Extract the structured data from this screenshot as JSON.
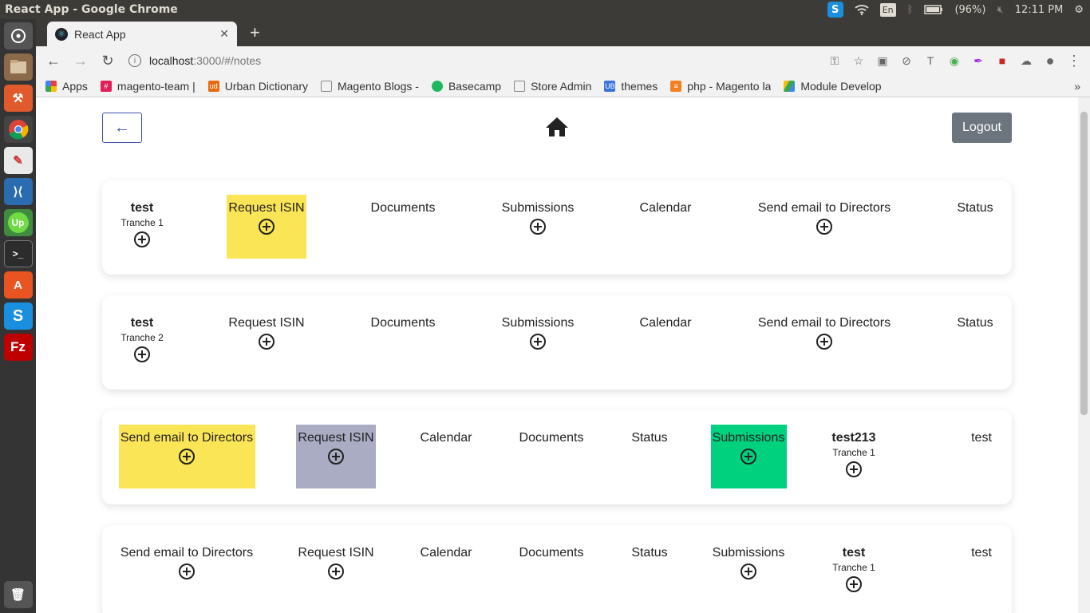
{
  "os": {
    "window_title": "React App - Google Chrome",
    "battery": "(96%)",
    "clock": "12:11 PM",
    "lang": "En"
  },
  "launcher": [
    "dash-icon",
    "files-icon",
    "tool-icon",
    "chrome-icon",
    "text-editor-icon",
    "vscode-icon",
    "upwork-icon",
    "terminal-icon",
    "software-center-icon",
    "skype-icon",
    "filezilla-icon",
    "trash-icon"
  ],
  "browser": {
    "tab_title": "React App",
    "url_host": "localhost",
    "url_path": ":3000/#/notes",
    "bookmarks": [
      {
        "label": "Apps",
        "color": "#e94235"
      },
      {
        "label": "magento-team |",
        "color": "#e01e5a"
      },
      {
        "label": "Urban Dictionary",
        "color": "#e86a10"
      },
      {
        "label": "Magento Blogs -",
        "color": "#888888"
      },
      {
        "label": "Basecamp",
        "color": "#1fb85f"
      },
      {
        "label": "Store Admin",
        "color": "#888888"
      },
      {
        "label": "themes",
        "color": "#3b73d9"
      },
      {
        "label": "php - Magento la",
        "color": "#f48024"
      },
      {
        "label": "Module Develop",
        "color": "#34a853"
      }
    ],
    "bookmarks_more": "»"
  },
  "header": {
    "back_icon": "←",
    "logout_label": "Logout"
  },
  "colors": {
    "yellow": "#fae556",
    "grey": "#a9acc2",
    "green": "#00d17f"
  },
  "rows": [
    {
      "cells": [
        {
          "kind": "name",
          "name": "test",
          "sub": "Tranche 1"
        },
        {
          "kind": "action",
          "label": "Request ISIN",
          "plus": true,
          "bg": "yellow"
        },
        {
          "kind": "action",
          "label": "Documents",
          "plus": false
        },
        {
          "kind": "action",
          "label": "Submissions",
          "plus": true
        },
        {
          "kind": "action",
          "label": "Calendar",
          "plus": false
        },
        {
          "kind": "action",
          "label": "Send email to Directors",
          "plus": true
        },
        {
          "kind": "action",
          "label": "Status",
          "plus": false
        }
      ]
    },
    {
      "cells": [
        {
          "kind": "name",
          "name": "test",
          "sub": "Tranche 2"
        },
        {
          "kind": "action",
          "label": "Request ISIN",
          "plus": true
        },
        {
          "kind": "action",
          "label": "Documents",
          "plus": false
        },
        {
          "kind": "action",
          "label": "Submissions",
          "plus": true
        },
        {
          "kind": "action",
          "label": "Calendar",
          "plus": false
        },
        {
          "kind": "action",
          "label": "Send email to Directors",
          "plus": true
        },
        {
          "kind": "action",
          "label": "Status",
          "plus": false
        }
      ]
    },
    {
      "cells": [
        {
          "kind": "action",
          "label": "Send email to Directors",
          "plus": true,
          "bg": "yellow"
        },
        {
          "kind": "action",
          "label": "Request ISIN",
          "plus": true,
          "bg": "grey"
        },
        {
          "kind": "action",
          "label": "Calendar",
          "plus": false
        },
        {
          "kind": "action",
          "label": "Documents",
          "plus": false
        },
        {
          "kind": "action",
          "label": "Status",
          "plus": false
        },
        {
          "kind": "action",
          "label": "Submissions",
          "plus": true,
          "bg": "green"
        },
        {
          "kind": "name",
          "name": "test213",
          "sub": "Tranche 1"
        },
        {
          "kind": "action",
          "label": "test",
          "plus": false
        }
      ]
    },
    {
      "cells": [
        {
          "kind": "action",
          "label": "Send email to Directors",
          "plus": true
        },
        {
          "kind": "action",
          "label": "Request ISIN",
          "plus": true
        },
        {
          "kind": "action",
          "label": "Calendar",
          "plus": false
        },
        {
          "kind": "action",
          "label": "Documents",
          "plus": false
        },
        {
          "kind": "action",
          "label": "Status",
          "plus": false
        },
        {
          "kind": "action",
          "label": "Submissions",
          "plus": true
        },
        {
          "kind": "name",
          "name": "test",
          "sub": "Tranche 1"
        },
        {
          "kind": "action",
          "label": "test",
          "plus": false
        }
      ]
    }
  ]
}
